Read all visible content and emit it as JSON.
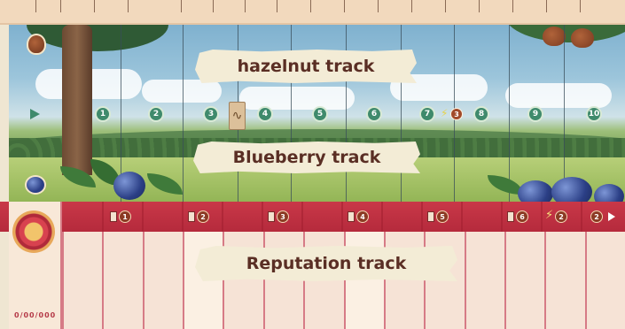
{
  "tracks": {
    "hazelnut_label": "hazelnut track",
    "blueberry_label": "Blueberry track",
    "reputation_label": "Reputation track"
  },
  "spaces": [
    "1",
    "2",
    "3",
    "4",
    "5",
    "6",
    "7",
    "8",
    "9",
    "10"
  ],
  "bonus_space_badge": "3",
  "reputation_badges": [
    "1",
    "2",
    "3",
    "4",
    "5",
    "6"
  ],
  "reputation_bolt_badge": "2",
  "reputation_end_badge": "2",
  "footer_dots": "0/00/000",
  "colors": {
    "space_green": "#3f8a6c",
    "reputation_red": "#c93848",
    "banner_text": "#5a2e24"
  },
  "icons": [
    "hazelnut-icon",
    "blueberry-icon",
    "rose-icon",
    "lightning-icon",
    "pawn-token"
  ]
}
